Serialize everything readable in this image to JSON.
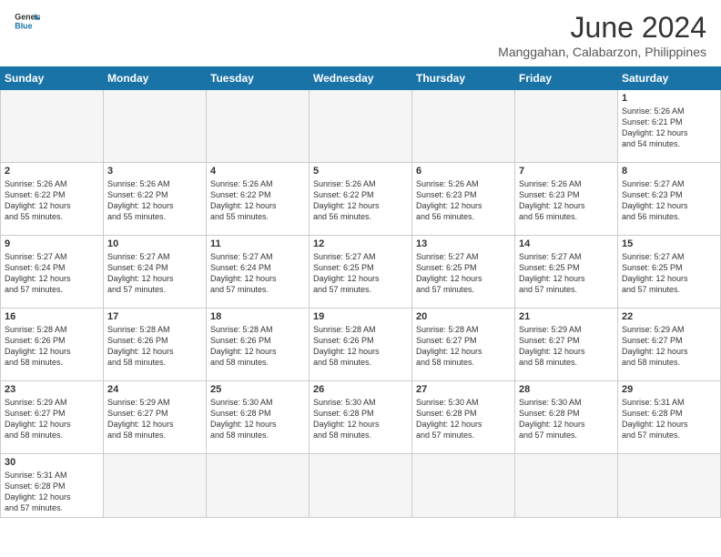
{
  "header": {
    "logo_general": "General",
    "logo_blue": "Blue",
    "month_title": "June 2024",
    "location": "Manggahan, Calabarzon, Philippines"
  },
  "days_of_week": [
    "Sunday",
    "Monday",
    "Tuesday",
    "Wednesday",
    "Thursday",
    "Friday",
    "Saturday"
  ],
  "weeks": [
    [
      {
        "day": null,
        "info": null
      },
      {
        "day": null,
        "info": null
      },
      {
        "day": null,
        "info": null
      },
      {
        "day": null,
        "info": null
      },
      {
        "day": null,
        "info": null
      },
      {
        "day": null,
        "info": null
      },
      {
        "day": "1",
        "info": "Sunrise: 5:26 AM\nSunset: 6:21 PM\nDaylight: 12 hours\nand 54 minutes."
      }
    ],
    [
      {
        "day": "2",
        "info": "Sunrise: 5:26 AM\nSunset: 6:22 PM\nDaylight: 12 hours\nand 55 minutes."
      },
      {
        "day": "3",
        "info": "Sunrise: 5:26 AM\nSunset: 6:22 PM\nDaylight: 12 hours\nand 55 minutes."
      },
      {
        "day": "4",
        "info": "Sunrise: 5:26 AM\nSunset: 6:22 PM\nDaylight: 12 hours\nand 55 minutes."
      },
      {
        "day": "5",
        "info": "Sunrise: 5:26 AM\nSunset: 6:22 PM\nDaylight: 12 hours\nand 56 minutes."
      },
      {
        "day": "6",
        "info": "Sunrise: 5:26 AM\nSunset: 6:23 PM\nDaylight: 12 hours\nand 56 minutes."
      },
      {
        "day": "7",
        "info": "Sunrise: 5:26 AM\nSunset: 6:23 PM\nDaylight: 12 hours\nand 56 minutes."
      },
      {
        "day": "8",
        "info": "Sunrise: 5:27 AM\nSunset: 6:23 PM\nDaylight: 12 hours\nand 56 minutes."
      }
    ],
    [
      {
        "day": "9",
        "info": "Sunrise: 5:27 AM\nSunset: 6:24 PM\nDaylight: 12 hours\nand 57 minutes."
      },
      {
        "day": "10",
        "info": "Sunrise: 5:27 AM\nSunset: 6:24 PM\nDaylight: 12 hours\nand 57 minutes."
      },
      {
        "day": "11",
        "info": "Sunrise: 5:27 AM\nSunset: 6:24 PM\nDaylight: 12 hours\nand 57 minutes."
      },
      {
        "day": "12",
        "info": "Sunrise: 5:27 AM\nSunset: 6:25 PM\nDaylight: 12 hours\nand 57 minutes."
      },
      {
        "day": "13",
        "info": "Sunrise: 5:27 AM\nSunset: 6:25 PM\nDaylight: 12 hours\nand 57 minutes."
      },
      {
        "day": "14",
        "info": "Sunrise: 5:27 AM\nSunset: 6:25 PM\nDaylight: 12 hours\nand 57 minutes."
      },
      {
        "day": "15",
        "info": "Sunrise: 5:27 AM\nSunset: 6:25 PM\nDaylight: 12 hours\nand 57 minutes."
      }
    ],
    [
      {
        "day": "16",
        "info": "Sunrise: 5:28 AM\nSunset: 6:26 PM\nDaylight: 12 hours\nand 58 minutes."
      },
      {
        "day": "17",
        "info": "Sunrise: 5:28 AM\nSunset: 6:26 PM\nDaylight: 12 hours\nand 58 minutes."
      },
      {
        "day": "18",
        "info": "Sunrise: 5:28 AM\nSunset: 6:26 PM\nDaylight: 12 hours\nand 58 minutes."
      },
      {
        "day": "19",
        "info": "Sunrise: 5:28 AM\nSunset: 6:26 PM\nDaylight: 12 hours\nand 58 minutes."
      },
      {
        "day": "20",
        "info": "Sunrise: 5:28 AM\nSunset: 6:27 PM\nDaylight: 12 hours\nand 58 minutes."
      },
      {
        "day": "21",
        "info": "Sunrise: 5:29 AM\nSunset: 6:27 PM\nDaylight: 12 hours\nand 58 minutes."
      },
      {
        "day": "22",
        "info": "Sunrise: 5:29 AM\nSunset: 6:27 PM\nDaylight: 12 hours\nand 58 minutes."
      }
    ],
    [
      {
        "day": "23",
        "info": "Sunrise: 5:29 AM\nSunset: 6:27 PM\nDaylight: 12 hours\nand 58 minutes."
      },
      {
        "day": "24",
        "info": "Sunrise: 5:29 AM\nSunset: 6:27 PM\nDaylight: 12 hours\nand 58 minutes."
      },
      {
        "day": "25",
        "info": "Sunrise: 5:30 AM\nSunset: 6:28 PM\nDaylight: 12 hours\nand 58 minutes."
      },
      {
        "day": "26",
        "info": "Sunrise: 5:30 AM\nSunset: 6:28 PM\nDaylight: 12 hours\nand 58 minutes."
      },
      {
        "day": "27",
        "info": "Sunrise: 5:30 AM\nSunset: 6:28 PM\nDaylight: 12 hours\nand 57 minutes."
      },
      {
        "day": "28",
        "info": "Sunrise: 5:30 AM\nSunset: 6:28 PM\nDaylight: 12 hours\nand 57 minutes."
      },
      {
        "day": "29",
        "info": "Sunrise: 5:31 AM\nSunset: 6:28 PM\nDaylight: 12 hours\nand 57 minutes."
      }
    ],
    [
      {
        "day": "30",
        "info": "Sunrise: 5:31 AM\nSunset: 6:28 PM\nDaylight: 12 hours\nand 57 minutes."
      },
      {
        "day": null,
        "info": null
      },
      {
        "day": null,
        "info": null
      },
      {
        "day": null,
        "info": null
      },
      {
        "day": null,
        "info": null
      },
      {
        "day": null,
        "info": null
      },
      {
        "day": null,
        "info": null
      }
    ]
  ]
}
